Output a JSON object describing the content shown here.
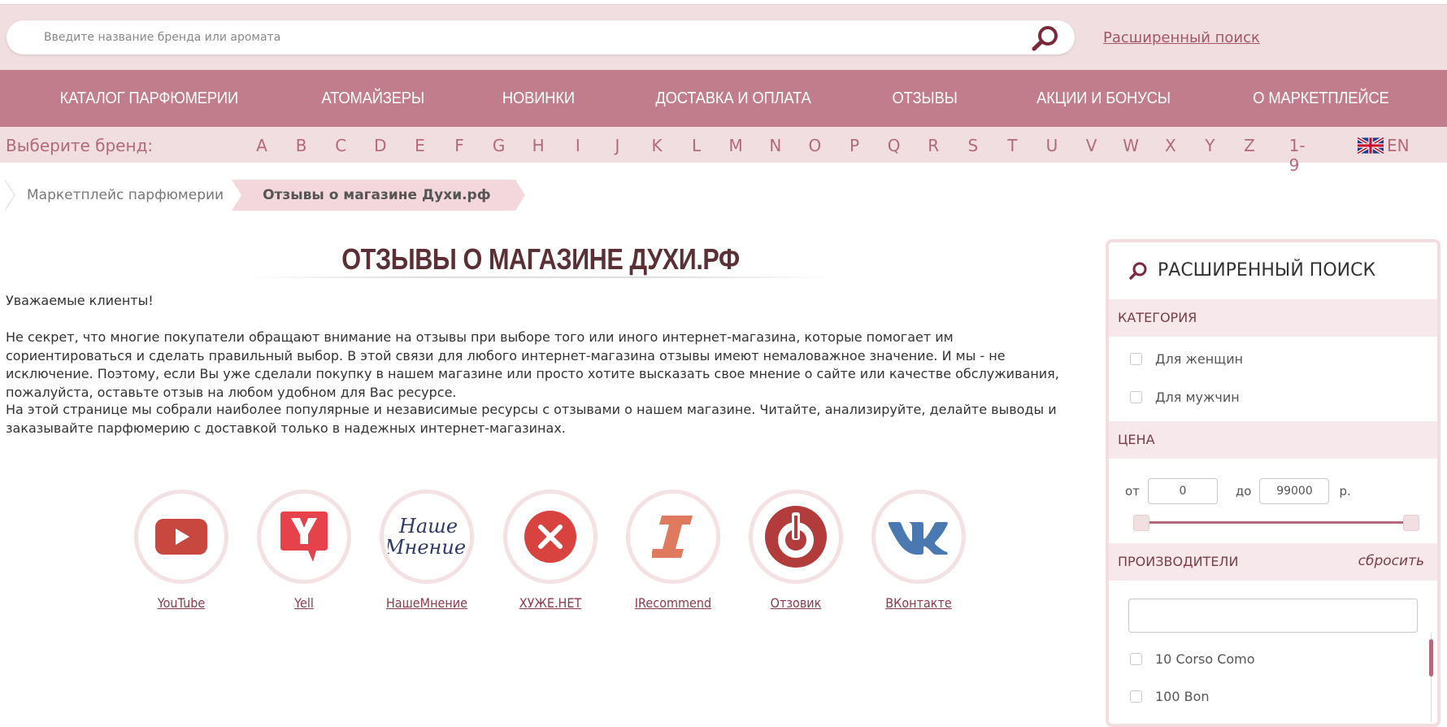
{
  "search": {
    "placeholder": "Введите название бренда или аромата",
    "advanced_link": "Расширенный поиск"
  },
  "nav": {
    "items": [
      "КАТАЛОГ ПАРФЮМЕРИИ",
      "АТОМАЙЗЕРЫ",
      "НОВИНКИ",
      "ДОСТАВКА И ОПЛАТА",
      "ОТЗЫВЫ",
      "АКЦИИ И БОНУСЫ",
      "О МАРКЕТПЛЕЙСЕ"
    ]
  },
  "brands": {
    "label": "Выберите бренд:",
    "letters": [
      "A",
      "B",
      "C",
      "D",
      "E",
      "F",
      "G",
      "H",
      "I",
      "J",
      "K",
      "L",
      "M",
      "N",
      "O",
      "P",
      "Q",
      "R",
      "S",
      "T",
      "U",
      "V",
      "W",
      "X",
      "Y",
      "Z",
      "1-9"
    ],
    "lang": "EN"
  },
  "breadcrumb": {
    "home": "Маркетплейс парфюмерии",
    "current": "Отзывы о магазине Духи.рф"
  },
  "page": {
    "title": "ОТЗЫВЫ О МАГАЗИНЕ ДУХИ.РФ",
    "greeting": "Уважаемые клиенты!",
    "para1": "Не секрет, что многие покупатели обращают внимание на отзывы при выборе того или иного интернет-магазина, которые помогает им сориентироваться и сделать правильный выбор. В этой связи для любого интернет-магазина отзывы имеют немаловажное значение. И мы - не исключение. Поэтому, если Вы уже сделали покупку в нашем магазине или просто хотите высказать свое мнение о сайте или качестве обслуживания, пожалуйста, оставьте отзыв на любом удобном для Вас ресурсе.",
    "para2": "На этой странице мы собрали наиболее популярные и независимые ресурсы с отзывами о нашем магазине. Читайте, анализируйте, делайте выводы и заказывайте парфюмерию с доставкой только в надежных интернет-магазинах."
  },
  "resources": [
    {
      "label": "YouTube",
      "icon": "youtube-icon"
    },
    {
      "label": "Yell",
      "icon": "yell-icon"
    },
    {
      "label": "НашеМнение",
      "icon": "nashe-mnenie-icon",
      "logo_text": [
        "Наше",
        "Мнение"
      ]
    },
    {
      "label": "ХУЖЕ.НЕТ",
      "icon": "khuzhe-net-icon"
    },
    {
      "label": "IRecommend",
      "icon": "irecommend-icon"
    },
    {
      "label": "Отзовик",
      "icon": "otzovik-icon"
    },
    {
      "label": "ВКонтакте",
      "icon": "vk-icon"
    }
  ],
  "sidebar": {
    "title": "РАСШИРЕННЫЙ ПОИСК",
    "category": {
      "label": "КАТЕГОРИЯ",
      "options": [
        "Для женщин",
        "Для мужчин"
      ]
    },
    "price": {
      "label": "ЦЕНА",
      "from_label": "от",
      "from": "0",
      "to_label": "до",
      "to": "99000",
      "currency": "р."
    },
    "manufacturers": {
      "label": "ПРОИЗВОДИТЕЛИ",
      "reset": "сбросить",
      "items": [
        "10 Corso Como",
        "100 Bon"
      ]
    }
  },
  "colors": {
    "accent": "#c17d8b",
    "band": "#f0dee0",
    "brand_dark": "#5a3036",
    "link": "#8b3a4a"
  }
}
